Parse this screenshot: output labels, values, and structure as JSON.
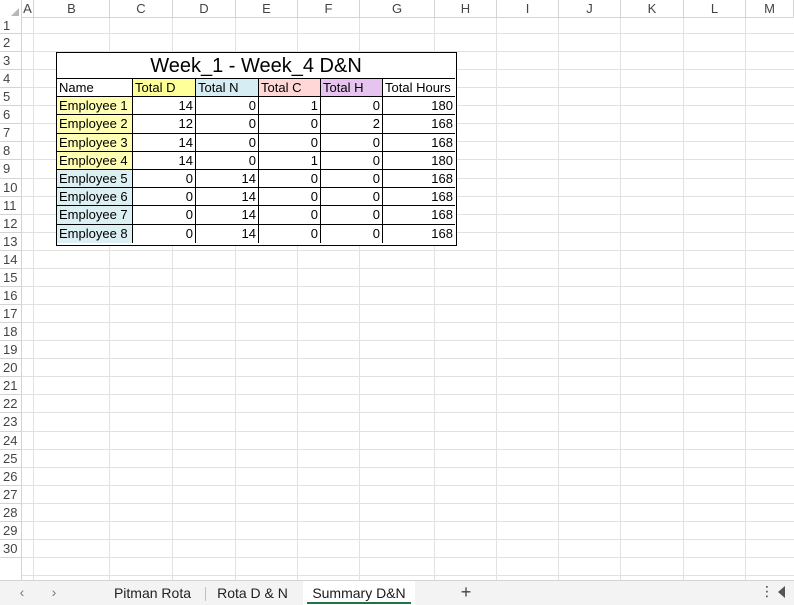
{
  "columns": [
    "A",
    "B",
    "C",
    "D",
    "E",
    "F",
    "G",
    "H",
    "I",
    "J",
    "K",
    "L",
    "M"
  ],
  "rows": [
    "1",
    "2",
    "3",
    "4",
    "5",
    "6",
    "7",
    "8",
    "9",
    "10",
    "11",
    "12",
    "13",
    "14",
    "15",
    "16",
    "17",
    "18",
    "19",
    "20",
    "21",
    "22",
    "23",
    "24",
    "25",
    "26",
    "27",
    "28",
    "29",
    "30"
  ],
  "table": {
    "title": "Week_1 - Week_4 D&N",
    "headers": [
      {
        "label": "Name",
        "color": "#ffffff"
      },
      {
        "label": "Total D",
        "color": "#ffff99"
      },
      {
        "label": "Total N",
        "color": "#d6eef3"
      },
      {
        "label": "Total C",
        "color": "#ffd7d7"
      },
      {
        "label": "Total H",
        "color": "#e6c4ef"
      },
      {
        "label": "Total Hours",
        "color": "#ffffff"
      }
    ],
    "rows": [
      {
        "name": "Employee 1",
        "name_color": "#ffffb3",
        "d": "14",
        "n": "0",
        "c": "1",
        "h": "0",
        "hours": "180"
      },
      {
        "name": "Employee 2",
        "name_color": "#ffffb3",
        "d": "12",
        "n": "0",
        "c": "0",
        "h": "2",
        "hours": "168"
      },
      {
        "name": "Employee 3",
        "name_color": "#ffffb3",
        "d": "14",
        "n": "0",
        "c": "0",
        "h": "0",
        "hours": "168"
      },
      {
        "name": "Employee 4",
        "name_color": "#ffffb3",
        "d": "14",
        "n": "0",
        "c": "1",
        "h": "0",
        "hours": "180"
      },
      {
        "name": "Employee 5",
        "name_color": "#dcf0f4",
        "d": "0",
        "n": "14",
        "c": "0",
        "h": "0",
        "hours": "168"
      },
      {
        "name": "Employee 6",
        "name_color": "#dcf0f4",
        "d": "0",
        "n": "14",
        "c": "0",
        "h": "0",
        "hours": "168"
      },
      {
        "name": "Employee 7",
        "name_color": "#dcf0f4",
        "d": "0",
        "n": "14",
        "c": "0",
        "h": "0",
        "hours": "168"
      },
      {
        "name": "Employee 8",
        "name_color": "#dcf0f4",
        "d": "0",
        "n": "14",
        "c": "0",
        "h": "0",
        "hours": "168"
      }
    ]
  },
  "sheet_tabs": [
    {
      "label": "Pitman Rota",
      "active": false
    },
    {
      "label": "Rota D & N",
      "active": false
    },
    {
      "label": "Summary D&N",
      "active": true
    }
  ],
  "tabbar": {
    "prev_icon": "chevron-left-icon",
    "next_icon": "chevron-right-icon",
    "add_label": "+",
    "more_label": "⋮",
    "prev_label": "‹",
    "next_label": "›"
  },
  "colors": {
    "accent": "#217346",
    "grid": "#e1e1e1",
    "header_border": "#d4d4d4"
  }
}
